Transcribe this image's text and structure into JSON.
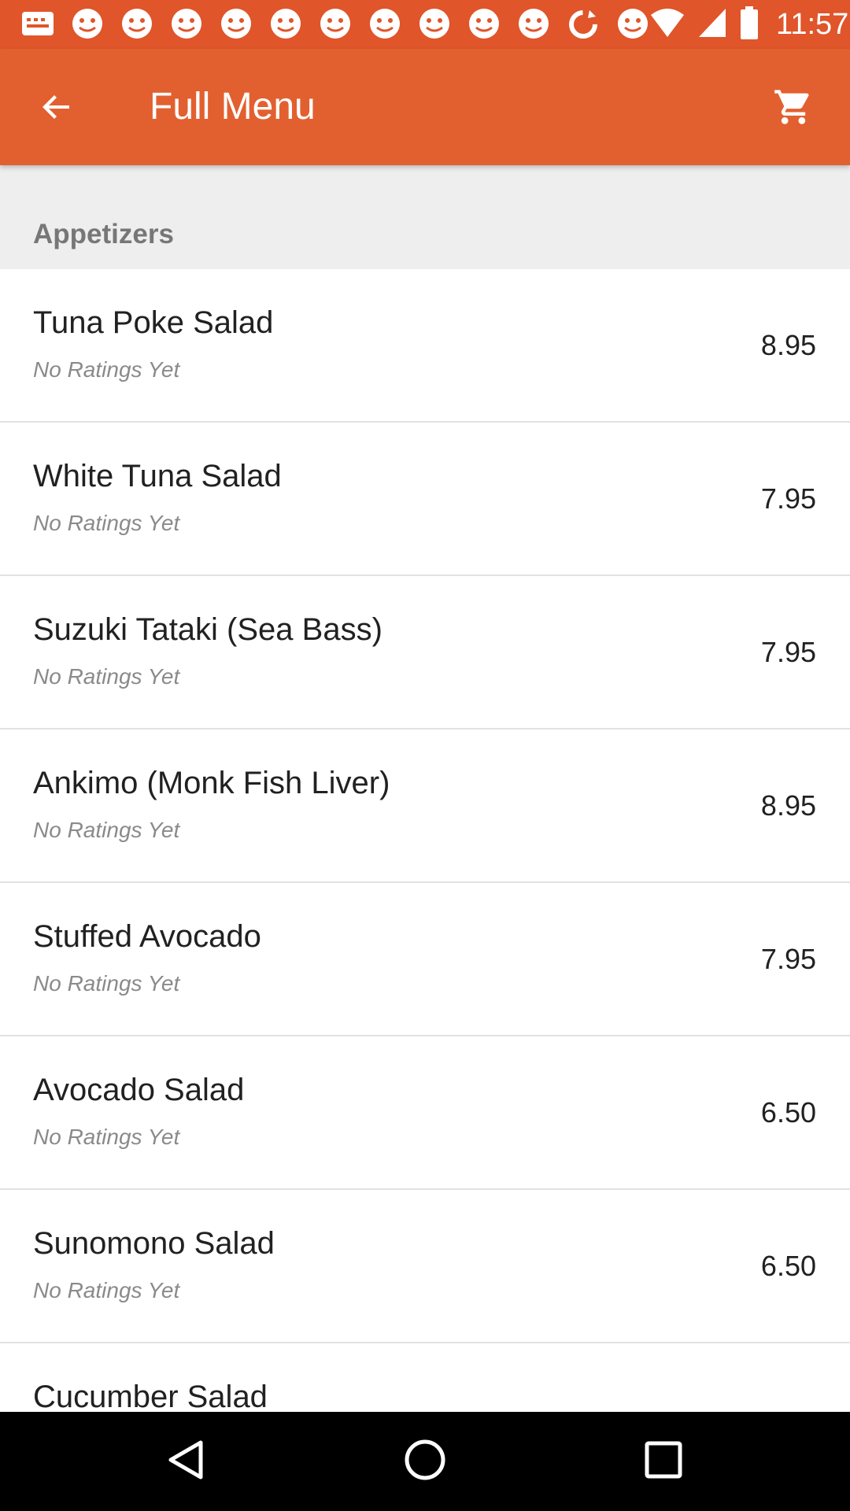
{
  "status_bar": {
    "time": "11:57",
    "notification_icons": [
      "message-icon",
      "whatsapp-icon",
      "whatsapp-icon",
      "whatsapp-icon",
      "whatsapp-icon",
      "whatsapp-icon",
      "whatsapp-icon",
      "whatsapp-icon",
      "whatsapp-icon",
      "whatsapp-icon",
      "whatsapp-icon",
      "sync-icon",
      "whatsapp-icon"
    ],
    "system_icons": [
      "wifi-icon",
      "signal-icon",
      "battery-icon"
    ]
  },
  "app_bar": {
    "title": "Full Menu",
    "back_icon": "back-arrow-icon",
    "cart_icon": "shopping-cart-icon"
  },
  "menu": {
    "section_title": "Appetizers",
    "items": [
      {
        "name": "Tuna Poke Salad",
        "rating": "No Ratings Yet",
        "price": "8.95"
      },
      {
        "name": "White Tuna Salad",
        "rating": "No Ratings Yet",
        "price": "7.95"
      },
      {
        "name": "Suzuki Tataki (Sea Bass)",
        "rating": "No Ratings Yet",
        "price": "7.95"
      },
      {
        "name": "Ankimo (Monk Fish Liver)",
        "rating": "No Ratings Yet",
        "price": "8.95"
      },
      {
        "name": "Stuffed Avocado",
        "rating": "No Ratings Yet",
        "price": "7.95"
      },
      {
        "name": "Avocado Salad",
        "rating": "No Ratings Yet",
        "price": "6.50"
      },
      {
        "name": "Sunomono Salad",
        "rating": "No Ratings Yet",
        "price": "6.50"
      },
      {
        "name": "Cucumber Salad",
        "rating": "",
        "price": ""
      }
    ]
  },
  "nav_bar": {
    "back_icon": "nav-back-icon",
    "home_icon": "nav-home-icon",
    "recents_icon": "nav-recents-icon"
  },
  "colors": {
    "status_bar": "#E0552A",
    "app_bar": "#E2602F",
    "section_background": "#EEEEEE",
    "nav_bar": "#000000"
  }
}
